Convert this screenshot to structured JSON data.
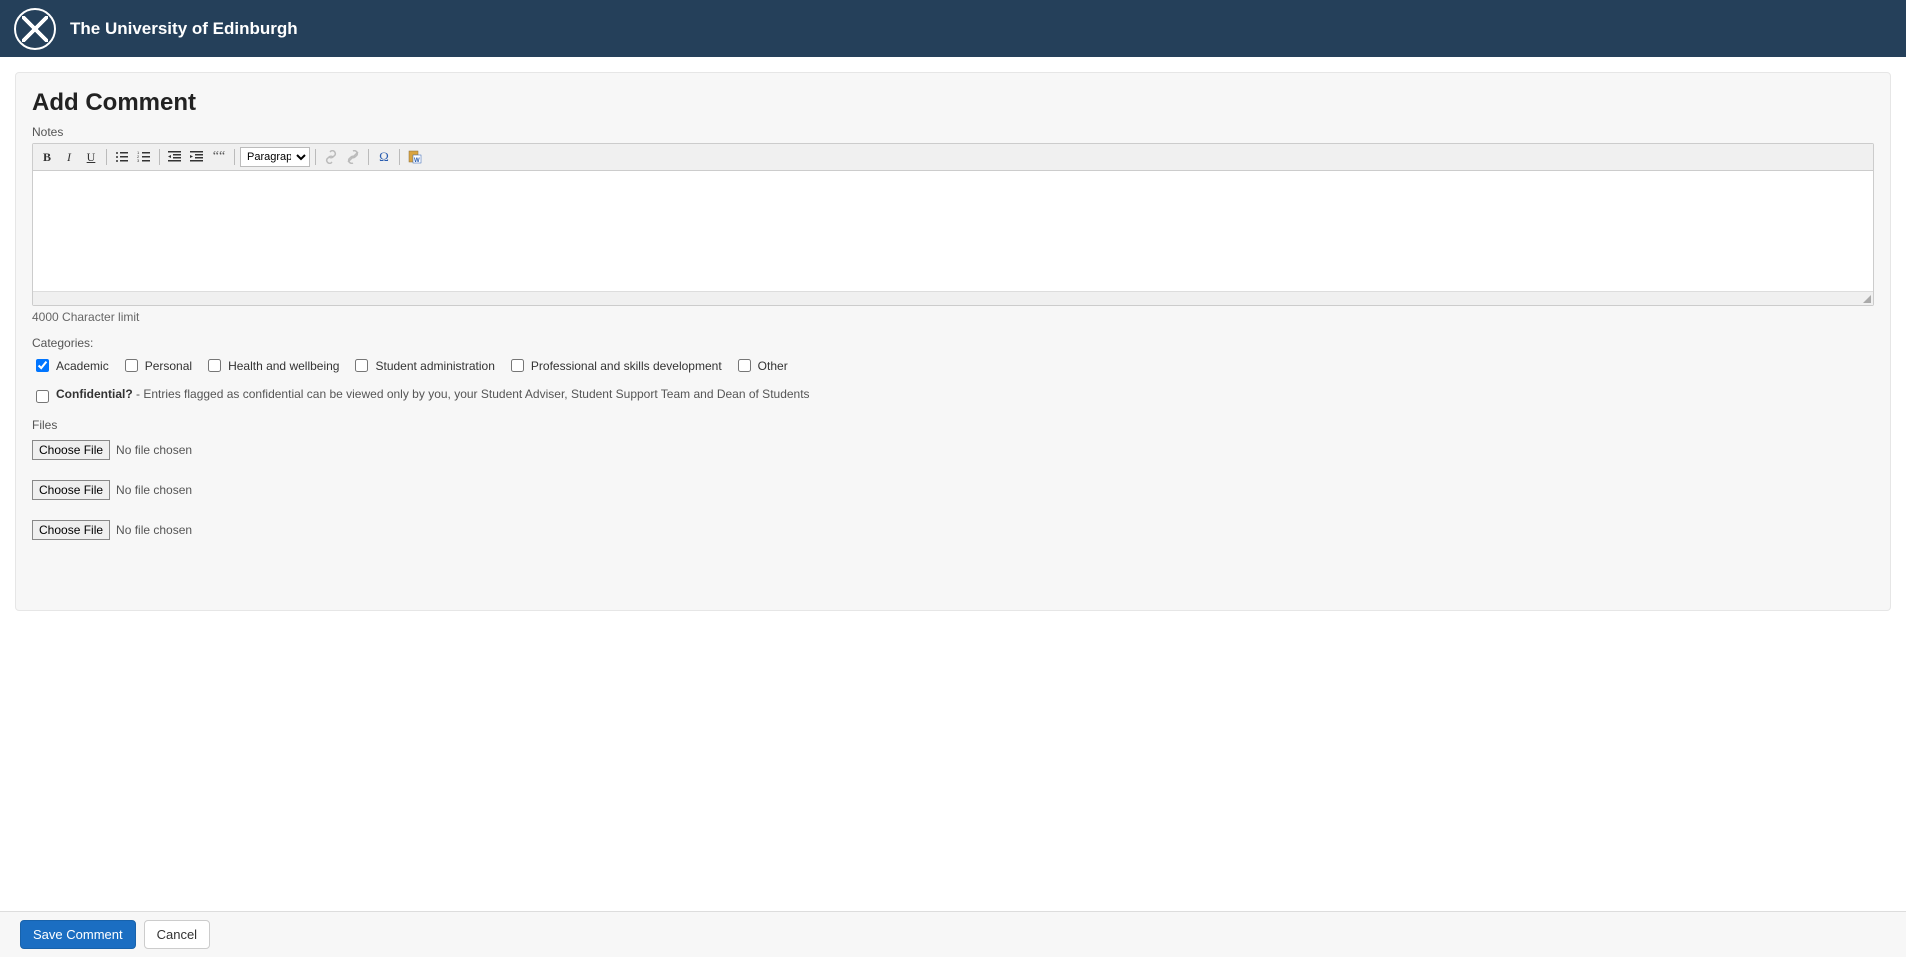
{
  "header": {
    "title": "The University of Edinburgh"
  },
  "page": {
    "title": "Add Comment",
    "notes_label": "Notes",
    "char_limit": "4000 Character limit"
  },
  "toolbar": {
    "format_select": "Paragraph"
  },
  "categories": {
    "label": "Categories:",
    "items": [
      {
        "label": "Academic",
        "checked": true
      },
      {
        "label": "Personal",
        "checked": false
      },
      {
        "label": "Health and wellbeing",
        "checked": false
      },
      {
        "label": "Student administration",
        "checked": false
      },
      {
        "label": "Professional and skills development",
        "checked": false
      },
      {
        "label": "Other",
        "checked": false
      }
    ]
  },
  "confidential": {
    "label": "Confidential?",
    "desc": "- Entries flagged as confidential can be viewed only by you, your Student Adviser, Student Support Team and Dean of Students",
    "checked": false
  },
  "files": {
    "label": "Files",
    "choose_label": "Choose File",
    "no_file": "No file chosen",
    "count": 3
  },
  "footer": {
    "save": "Save Comment",
    "cancel": "Cancel"
  }
}
